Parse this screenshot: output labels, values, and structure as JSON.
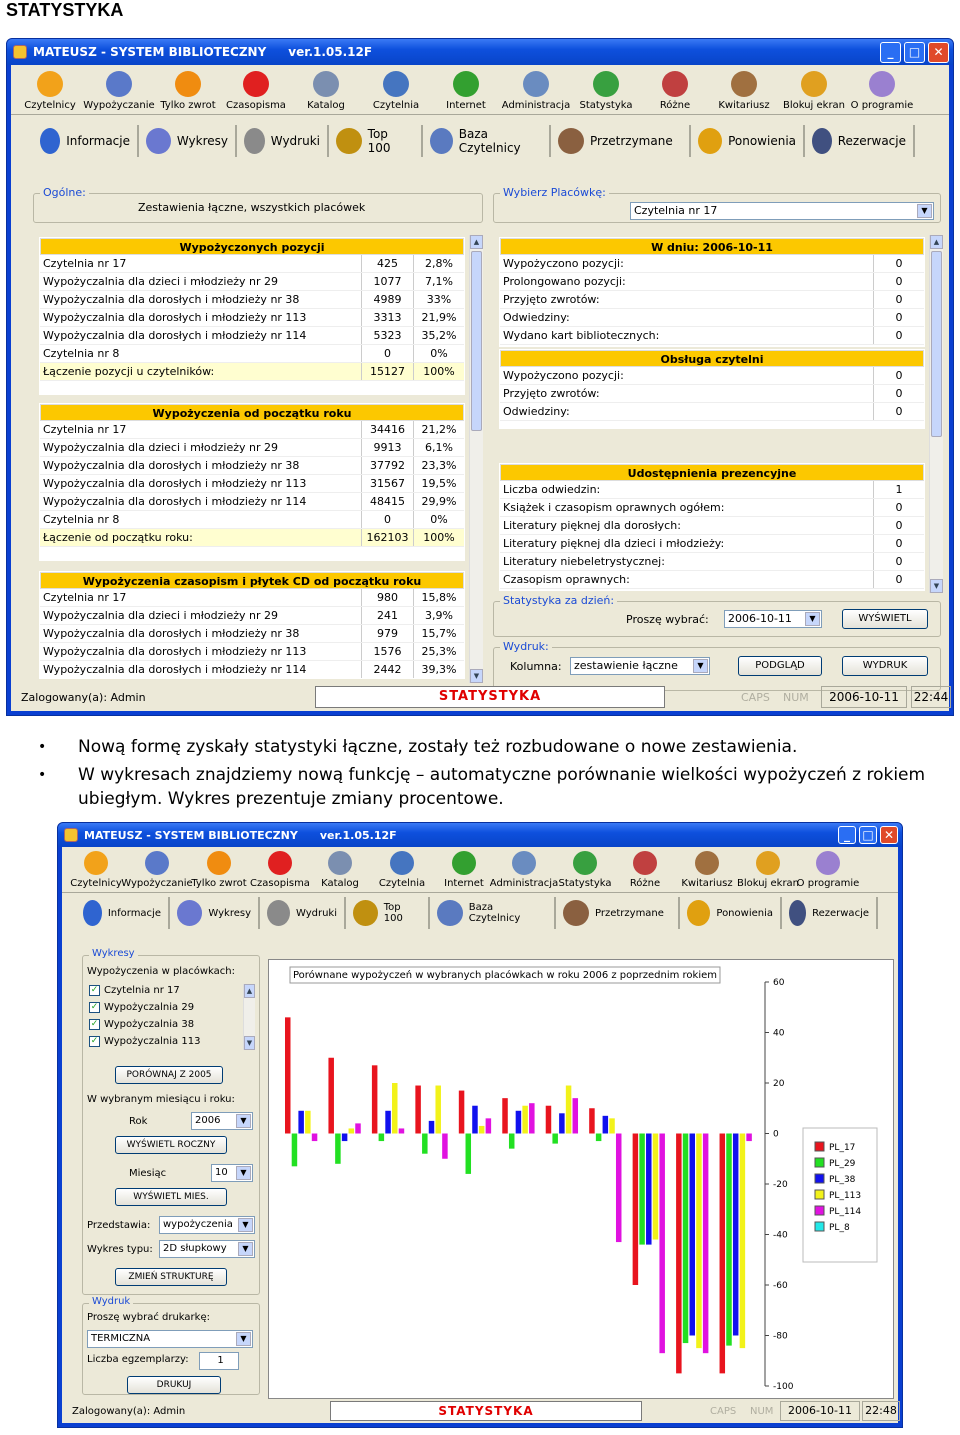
{
  "heading": "STATYSTYKA",
  "window1": {
    "title": "MATEUSZ - SYSTEM BIBLIOTECZNY",
    "version": "ver.1.05.12F",
    "toolbar": [
      {
        "label": "Czytelnicy",
        "icon": "smiley-icon",
        "color": "#f2a21a"
      },
      {
        "label": "Wypożyczanie",
        "icon": "book-out-icon",
        "color": "#5a79c9"
      },
      {
        "label": "Tylko zwrot",
        "icon": "down-arrow-icon",
        "color": "#f08c10"
      },
      {
        "label": "Czasopisma",
        "icon": "red-x-icon",
        "color": "#e02020"
      },
      {
        "label": "Katalog",
        "icon": "magnifier-icon",
        "color": "#7b8fb0"
      },
      {
        "label": "Czytelnia",
        "icon": "books-icon",
        "color": "#4575c0"
      },
      {
        "label": "Internet",
        "icon": "globe-icon",
        "color": "#33a030"
      },
      {
        "label": "Administracja",
        "icon": "gears-icon",
        "color": "#6a8cc0"
      },
      {
        "label": "Statystyka",
        "icon": "chart-icon",
        "color": "#38a040"
      },
      {
        "label": "Różne",
        "icon": "calendar-icon",
        "color": "#c04040"
      },
      {
        "label": "Kwitariusz",
        "icon": "cards-icon",
        "color": "#a07040"
      },
      {
        "label": "Blokuj ekran",
        "icon": "lock-icon",
        "color": "#e0a020"
      },
      {
        "label": "O programie",
        "icon": "bulb-icon",
        "color": "#9a80d0"
      }
    ],
    "tabs": [
      {
        "label": "Informacje",
        "icon": "info-icon",
        "color": "#2f64d0"
      },
      {
        "label": "Wykresy",
        "icon": "pie-chart-icon",
        "color": "#6a78d0"
      },
      {
        "label": "Wydruki",
        "icon": "printer-icon",
        "color": "#8a8a8a"
      },
      {
        "label": "Top 100",
        "icon": "trophy-icon",
        "color": "#c09010"
      },
      {
        "label": "Baza Czytelnicy",
        "icon": "people-icon",
        "color": "#5a7ac0"
      },
      {
        "label": "Przetrzymane",
        "icon": "handshake-icon",
        "color": "#8a6040"
      },
      {
        "label": "Ponowienia",
        "icon": "warning-icon",
        "color": "#e0a010"
      },
      {
        "label": "Rezerwacje",
        "icon": "books-shelf-icon",
        "color": "#405080"
      }
    ],
    "ogolne_label": "Ogólne:",
    "ogolne_text": "Zestawienia łączne, wszystkich placówek",
    "placowka_label": "Wybierz Placówkę:",
    "placowka_value": "Czytelnia nr 17",
    "tables_left": [
      {
        "title": "Wypożyczonych pozycji",
        "rows": [
          [
            "Czytelnia nr 17",
            "425",
            "2,8%"
          ],
          [
            "Wypożyczalnia dla dzieci i młodzieży nr 29",
            "1077",
            "7,1%"
          ],
          [
            "Wypożyczalnia dla dorosłych i młodzieży nr 38",
            "4989",
            "33%"
          ],
          [
            "Wypożyczalnia dla dorosłych i młodzieży nr 113",
            "3313",
            "21,9%"
          ],
          [
            "Wypożyczalnia dla dorosłych i młodzieży nr 114",
            "5323",
            "35,2%"
          ],
          [
            "Czytelnia nr 8",
            "0",
            "0%"
          ]
        ],
        "sum": [
          "Łączenie pozycji u czytelników:",
          "15127",
          "100%"
        ]
      },
      {
        "title": "Wypożyczenia od początku roku",
        "rows": [
          [
            "Czytelnia nr 17",
            "34416",
            "21,2%"
          ],
          [
            "Wypożyczalnia dla dzieci i młodzieży nr 29",
            "9913",
            "6,1%"
          ],
          [
            "Wypożyczalnia dla dorosłych i młodzieży nr 38",
            "37792",
            "23,3%"
          ],
          [
            "Wypożyczalnia dla dorosłych i młodzieży nr 113",
            "31567",
            "19,5%"
          ],
          [
            "Wypożyczalnia dla dorosłych i młodzieży nr 114",
            "48415",
            "29,9%"
          ],
          [
            "Czytelnia nr 8",
            "0",
            "0%"
          ]
        ],
        "sum": [
          "Łączenie od początku roku:",
          "162103",
          "100%"
        ]
      },
      {
        "title": "Wypożyczenia czasopism i płytek CD od początku roku",
        "rows": [
          [
            "Czytelnia nr 17",
            "980",
            "15,8%"
          ],
          [
            "Wypożyczalnia dla dzieci i młodzieży nr 29",
            "241",
            "3,9%"
          ],
          [
            "Wypożyczalnia dla dorosłych i młodzieży nr 38",
            "979",
            "15,7%"
          ],
          [
            "Wypożyczalnia dla dorosłych i młodzieży nr 113",
            "1576",
            "25,3%"
          ],
          [
            "Wypożyczalnia dla dorosłych i młodzieży nr 114",
            "2442",
            "39,3%"
          ]
        ],
        "sum": null
      }
    ],
    "tables_right": [
      {
        "title": "W dniu: 2006-10-11",
        "rows": [
          [
            "Wypożyczono pozycji:",
            "0"
          ],
          [
            "Prolongowano pozycji:",
            "0"
          ],
          [
            "Przyjęto zwrotów:",
            "0"
          ],
          [
            "Odwiedziny:",
            "0"
          ],
          [
            "Wydano kart bibliotecznych:",
            "0"
          ]
        ]
      },
      {
        "title": "Obsługa czytelni",
        "rows": [
          [
            "Wypożyczono pozycji:",
            "0"
          ],
          [
            "Przyjęto zwrotów:",
            "0"
          ],
          [
            "Odwiedziny:",
            "0"
          ]
        ]
      },
      {
        "title": "Udostępnienia prezencyjne",
        "rows": [
          [
            "Liczba odwiedzin:",
            "1"
          ],
          [
            "Książek i czasopism oprawnych ogółem:",
            "0"
          ],
          [
            "Literatury pięknej dla dorosłych:",
            "0"
          ],
          [
            "Literatury pięknej dla dzieci i młodzieży:",
            "0"
          ],
          [
            "Literatury niebeletrystycznej:",
            "0"
          ],
          [
            "Czasopism oprawnych:",
            "0"
          ]
        ]
      }
    ],
    "stat_label": "Statystyka za dzień:",
    "prosze_wybrac": "Proszę wybrać:",
    "date_value": "2006-10-11",
    "wyswietl": "WYŚWIETL",
    "wydruk_label": "Wydruk:",
    "kolumna_label": "Kolumna:",
    "kolumna_value": "zestawienie łączne",
    "podglad": "PODGLĄD",
    "wydruk_btn": "WYDRUK",
    "status": {
      "user": "Zalogowany(a): Admin",
      "center": "STATYSTYKA",
      "caps": "CAPS",
      "num": "NUM",
      "date": "2006-10-11",
      "time": "22:44"
    }
  },
  "bullets": [
    "Nową formę zyskały statystyki łączne, zostały też rozbudowane o nowe zestawienia.",
    "W wykresach znajdziemy nową funkcję – automatyczne porównanie wielkości wypożyczeń z rokiem ubiegłym. Wykres prezentuje zmiany procentowe."
  ],
  "window2": {
    "title": "MATEUSZ - SYSTEM BIBLIOTECZNY",
    "version": "ver.1.05.12F",
    "wykresy_label": "Wykresy",
    "w_placowkach": "Wypożyczenia w placówkach:",
    "checks": [
      "Czytelnia nr 17",
      "Wypożyczalnia 29",
      "Wypożyczalnia 38",
      "Wypożyczalnia 113"
    ],
    "porownaj": "PORÓWNAJ Z 2005",
    "w_miesiacu": "W wybranym miesiącu i roku:",
    "rok_label": "Rok",
    "rok_value": "2006",
    "wysw_roczny": "WYŚWIETL ROCZNY",
    "miesiac_label": "Miesiąc",
    "miesiac_value": "10",
    "wysw_mies": "WYŚWIETL MIES.",
    "przedstawia_label": "Przedstawia:",
    "przedstawia_value": "wypożyczenia",
    "typ_label": "Wykres typu:",
    "typ_value": "2D słupkowy",
    "zmien": "ZMIEŃ STRUKTURĘ",
    "wydruk_label": "Wydruk",
    "drukarka_label": "Proszę wybrać drukarkę:",
    "drukarka_value": "TERMICZNA",
    "egz_label": "Liczba egzemplarzy:",
    "egz_value": "1",
    "drukuj": "DRUKUJ",
    "status": {
      "user": "Zalogowany(a): Admin",
      "center": "STATYSTYKA",
      "caps": "CAPS",
      "num": "NUM",
      "date": "2006-10-11",
      "time": "22:48"
    }
  },
  "chart_data": {
    "type": "bar",
    "title": "Porównane wypożyczeń w wybranych placówkach w roku 2006 z poprzednim rokiem",
    "ylim": [
      -100,
      60
    ],
    "yticks": [
      60,
      40,
      20,
      0,
      -20,
      -40,
      -60,
      -80,
      -100
    ],
    "legend_position": "right",
    "series": [
      {
        "name": "PL_17",
        "color": "#e8141e",
        "values": [
          46,
          30,
          27,
          19,
          17,
          14,
          11,
          10,
          -60,
          -95,
          -95
        ]
      },
      {
        "name": "PL_29",
        "color": "#22e022",
        "values": [
          -13,
          -12,
          -3,
          -8,
          -16,
          -6,
          -4,
          -3,
          -44,
          -83,
          -84
        ]
      },
      {
        "name": "PL_38",
        "color": "#1111ee",
        "values": [
          9,
          -3,
          9,
          5,
          11,
          9,
          8,
          7,
          -44,
          -80,
          -80
        ]
      },
      {
        "name": "PL_113",
        "color": "#f2f21a",
        "values": [
          9,
          2,
          20,
          19,
          3,
          11,
          19,
          6,
          -42,
          -85,
          -85
        ]
      },
      {
        "name": "PL_114",
        "color": "#e012e0",
        "values": [
          -3,
          4,
          2,
          -10,
          6,
          12,
          14,
          -43,
          -87,
          -87,
          -3
        ]
      },
      {
        "name": "PL_8",
        "color": "#22e8e8",
        "values": [
          0,
          0,
          0,
          0,
          0,
          0,
          0,
          0,
          0,
          0,
          0
        ]
      }
    ]
  }
}
